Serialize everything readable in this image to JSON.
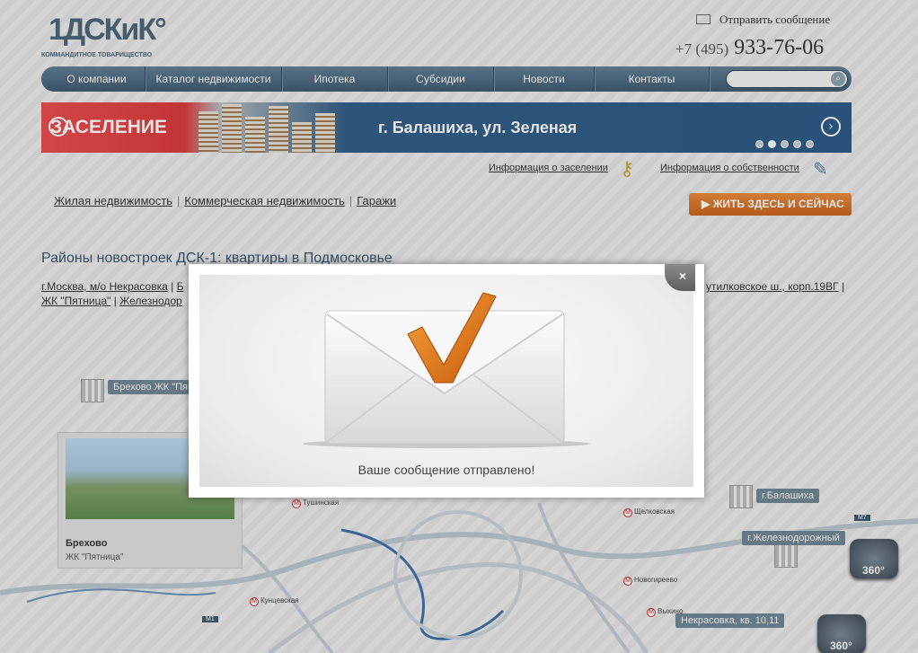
{
  "header": {
    "logo_text": "1ДСКиК°",
    "logo_subtitle": "КОММАНДИТНОЕ ТОВАРИЩЕСТВО",
    "send_message": "Отправить сообщение",
    "phone_code": "+7 (495)",
    "phone_number": "933-76-06"
  },
  "nav": {
    "items": [
      "О компании",
      "Каталог недвижимости",
      "Ипотека",
      "Субсидии",
      "Новости",
      "Контакты"
    ],
    "search_placeholder": ""
  },
  "banner": {
    "left_text": "ЗАСЕЛЕНИЕ",
    "right_text": "г. Балашиха, ул. Зеленая",
    "slides": 5,
    "active_slide": 2
  },
  "info_links": {
    "settlement": "Информация о заселении",
    "ownership": "Информация о собственности"
  },
  "tabs": {
    "residential": "Жилая недвижимость",
    "commercial": "Коммерческая недвижимость",
    "garages": "Гаражи"
  },
  "live_button": "ЖИТЬ ЗДЕСЬ И СЕЙЧАС",
  "main": {
    "heading": "Районы новостроек ДСК-1: квартиры в Подмосковье",
    "links_row1_a": "г.Москва, м/о Некрасовка",
    "links_row1_b": "Б",
    "links_row1_right": "утилковское ш., корп.19ВГ",
    "links_row2_a": "ЖК \"Пятница\"",
    "links_row2_b": "Железнодор"
  },
  "map": {
    "tags": {
      "brekhovo": "Брехово ЖК \"Пя",
      "balashikha": "г.Балашиха",
      "zheleznodorozhny": "г.Железнодорожный",
      "nekrasovka": "Некрасовка, кв. 10,11"
    },
    "card": {
      "title": "Брехово",
      "subtitle": "ЖК \"Пятница\""
    },
    "metro": [
      "Тушинская",
      "Щелковская",
      "Новогиреево",
      "Кунцевская",
      "Выхино"
    ],
    "highways": [
      "M7",
      "M1"
    ],
    "pano": "360°"
  },
  "modal": {
    "message": "Ваше сообщение отправлено!",
    "close": "×"
  },
  "colors": {
    "nav": "#4a667d",
    "accent": "#d9701f",
    "banner_red": "#e03c3c",
    "banner_blue": "#2a5785"
  }
}
